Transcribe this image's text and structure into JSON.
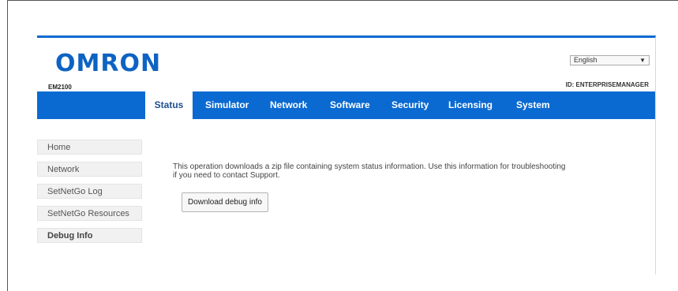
{
  "header": {
    "logo": "OMRON",
    "model": "EM2100",
    "language": "English",
    "device_id": "ID: ENTERPRISEMANAGER"
  },
  "nav": {
    "tabs": [
      {
        "label": "Status",
        "active": true
      },
      {
        "label": "Simulator"
      },
      {
        "label": "Network"
      },
      {
        "label": "Software"
      },
      {
        "label": "Security"
      },
      {
        "label": "Licensing"
      },
      {
        "label": "System"
      }
    ]
  },
  "sidebar": {
    "items": [
      {
        "label": "Home"
      },
      {
        "label": "Network"
      },
      {
        "label": "SetNetGo Log"
      },
      {
        "label": "SetNetGo Resources"
      },
      {
        "label": "Debug Info",
        "active": true
      }
    ]
  },
  "main": {
    "description": "This operation downloads a zip file containing system status information. Use this information for troubleshooting if you need to contact Support.",
    "download_button": "Download debug info"
  },
  "colors": {
    "brand_blue": "#0a6ad1",
    "logo_blue": "#0d63c3"
  }
}
